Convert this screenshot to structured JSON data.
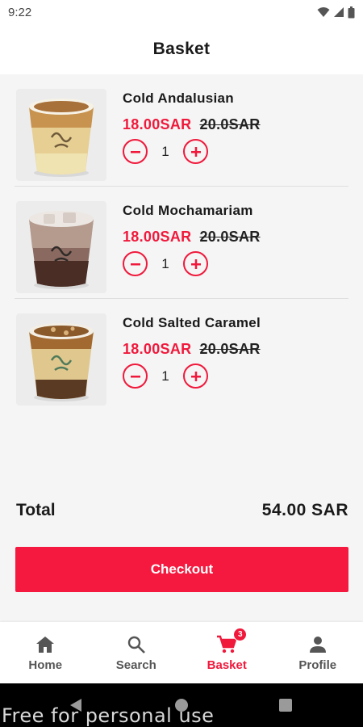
{
  "status_bar": {
    "time": "9:22"
  },
  "header": {
    "title": "Basket"
  },
  "items": [
    {
      "name": "Cold Andalusian",
      "price": "18.00SAR",
      "old_price": "20.0SAR",
      "quantity": "1",
      "drink": "latte"
    },
    {
      "name": "Cold Mochamariam",
      "price": "18.00SAR",
      "old_price": "20.0SAR",
      "quantity": "1",
      "drink": "mocha"
    },
    {
      "name": "Cold Salted Caramel",
      "price": "18.00SAR",
      "old_price": "20.0SAR",
      "quantity": "1",
      "drink": "caramel"
    }
  ],
  "summary": {
    "total_label": "Total",
    "total_value": "54.00 SAR"
  },
  "checkout": {
    "label": "Checkout"
  },
  "nav": {
    "home": "Home",
    "search": "Search",
    "basket": "Basket",
    "basket_badge": "3",
    "profile": "Profile",
    "active": "basket"
  },
  "watermark": "Free for personal use",
  "colors": {
    "accent": "#f0193c",
    "background": "#f5f5f5"
  },
  "icons": [
    "wifi-icon",
    "signal-icon",
    "battery-icon",
    "minus-icon",
    "plus-icon",
    "home-icon",
    "search-icon",
    "cart-icon",
    "person-icon",
    "back-icon",
    "home-circle-icon",
    "recents-icon"
  ]
}
